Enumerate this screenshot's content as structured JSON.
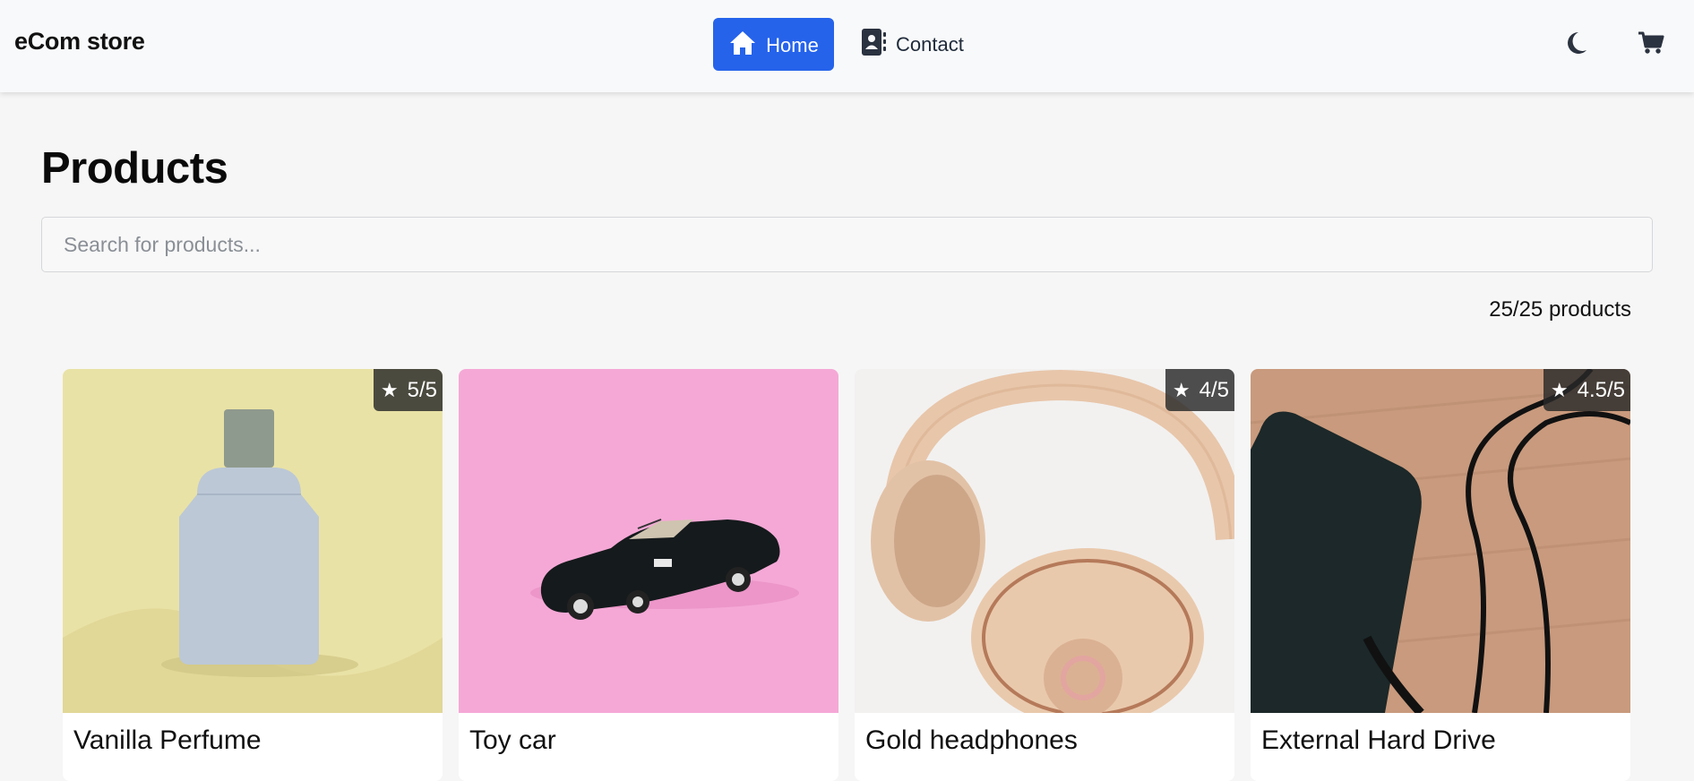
{
  "header": {
    "brand": "eCom store",
    "nav": [
      {
        "label": "Home",
        "active": true
      },
      {
        "label": "Contact",
        "active": false
      }
    ],
    "accent_color": "#2563eb",
    "icons": [
      "moon-icon",
      "cart-icon"
    ]
  },
  "main": {
    "title": "Products",
    "search": {
      "placeholder": "Search for products...",
      "value": ""
    },
    "count": "25/25 products",
    "products": [
      {
        "name": "Vanilla Perfume",
        "rating": "5/5"
      },
      {
        "name": "Toy car",
        "rating": ""
      },
      {
        "name": "Gold headphones",
        "rating": "4/5"
      },
      {
        "name": "External Hard Drive",
        "rating": "4.5/5"
      }
    ]
  }
}
